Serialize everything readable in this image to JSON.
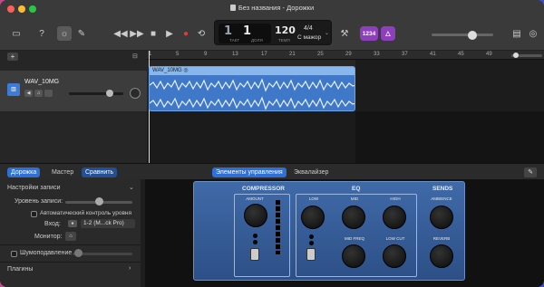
{
  "window": {
    "title": "Без названия - Дорожки"
  },
  "lcd": {
    "bar": "1",
    "beat": "1",
    "bar_label": "ТАКТ",
    "beat_label": "ДОЛЯ",
    "tempo": "120",
    "tempo_label": "ТЕМП",
    "signature": "4/4",
    "key": "С мажор"
  },
  "count_in": "1234",
  "ruler": {
    "ticks": [
      "1",
      "5",
      "9",
      "13",
      "17",
      "21",
      "25",
      "29",
      "33",
      "37",
      "41",
      "45",
      "49"
    ]
  },
  "track": {
    "name": "WAV_10MG"
  },
  "region": {
    "name": "WAV_10MG"
  },
  "bottom_tabs": {
    "track": "Дорожка",
    "master": "Мастер",
    "compare": "Сравнить",
    "controls": "Элементы управления",
    "eq": "Эквалайзер"
  },
  "recording": {
    "header": "Настройки записи",
    "level_label": "Уровень записи:",
    "auto_level_label": "Автоматический контроль уровня",
    "input_label": "Вход:",
    "input_value": "1-2  (M...ck Pro)",
    "monitor_label": "Монитор:",
    "noise_label": "Шумоподавление",
    "plugins_label": "Плагины"
  },
  "amp": {
    "compressor": "COMPRESSOR",
    "eq": "EQ",
    "sends": "SENDS",
    "amount": "AMOUNT",
    "low": "LOW",
    "mid": "MID",
    "high": "HIGH",
    "mid_freq": "MID FREQ",
    "low_cut": "LOW CUT",
    "ambience": "AMBIENCE",
    "reverb": "REVERB"
  }
}
